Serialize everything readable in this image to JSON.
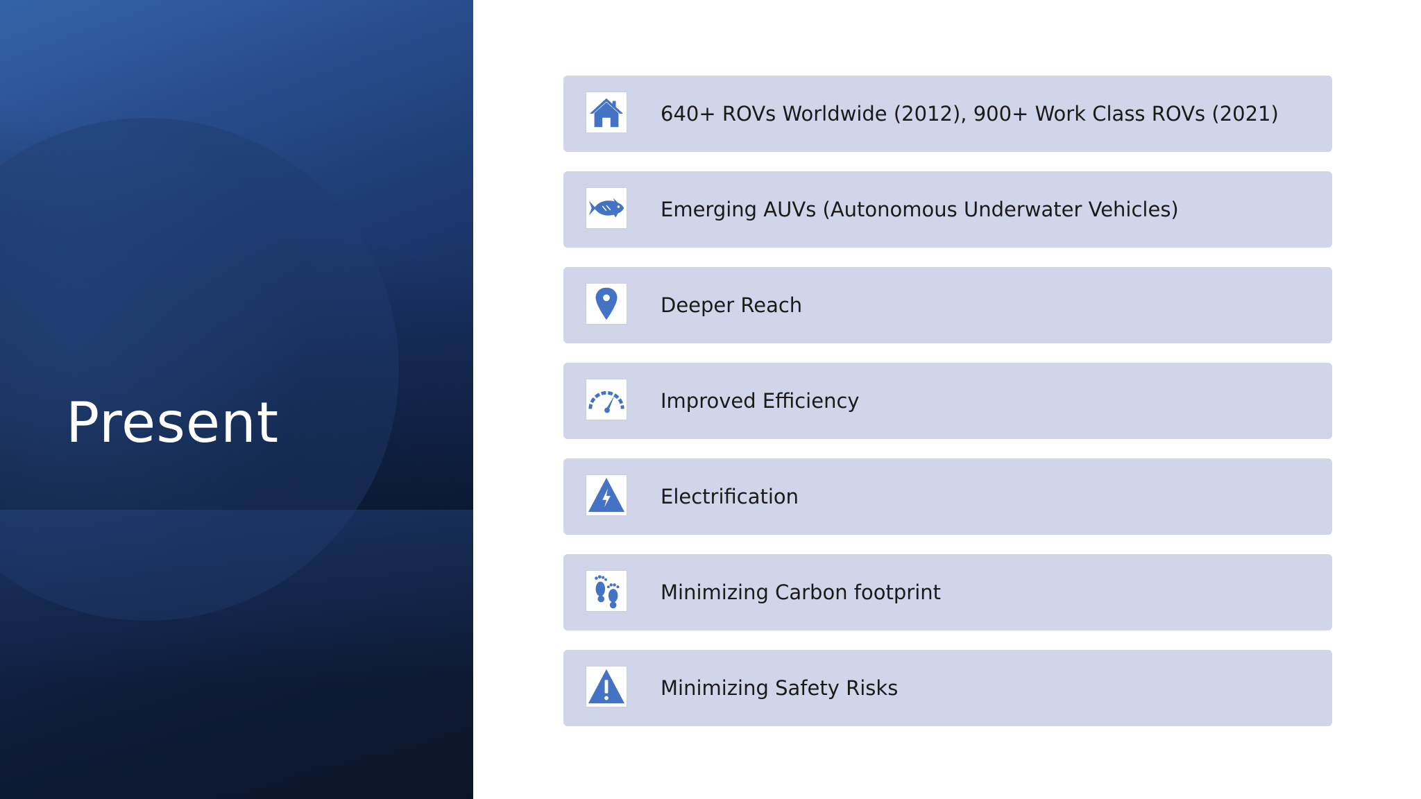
{
  "slide": {
    "title": "Present",
    "accent_color": "#4472c4",
    "card_color": "#d0d5ea",
    "panel_colors": [
      "#3563a8",
      "#172e5e",
      "#0b1528"
    ]
  },
  "items": [
    {
      "label": "640+ ROVs Worldwide (2012), 900+ Work Class ROVs (2021)",
      "icon": "house-icon"
    },
    {
      "label": "Emerging AUVs (Autonomous Underwater Vehicles)",
      "icon": "fish-icon"
    },
    {
      "label": "Deeper Reach",
      "icon": "map-pin-icon"
    },
    {
      "label": "Improved Efficiency",
      "icon": "speedometer-icon"
    },
    {
      "label": "Electrification",
      "icon": "high-voltage-icon"
    },
    {
      "label": "Minimizing Carbon footprint",
      "icon": "footprints-icon"
    },
    {
      "label": "Minimizing Safety Risks",
      "icon": "warning-icon"
    }
  ]
}
